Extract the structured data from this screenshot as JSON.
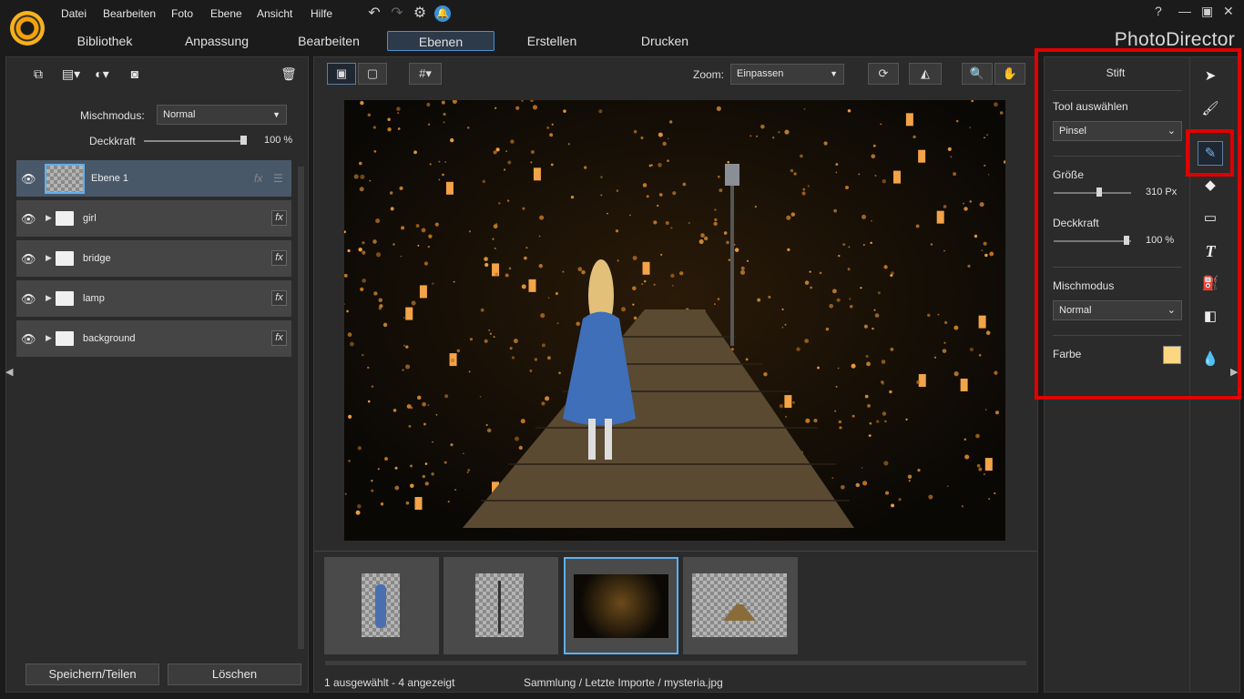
{
  "menu": {
    "file": "Datei",
    "edit": "Bearbeiten",
    "photo": "Foto",
    "layer": "Ebene",
    "view": "Ansicht",
    "help": "Hilfe"
  },
  "tabs": [
    "Bibliothek",
    "Anpassung",
    "Bearbeiten",
    "Ebenen",
    "Erstellen",
    "Drucken"
  ],
  "active_tab": "Ebenen",
  "app_title": "PhotoDirector",
  "window_controls": {
    "help": "?",
    "minimize": "—",
    "restore": "▣",
    "close": "✕"
  },
  "layers_panel": {
    "blend_label": "Mischmodus:",
    "blend_value": "Normal",
    "opacity_label": "Deckkraft",
    "opacity_value": "100 %",
    "layers": [
      {
        "name": "Ebene 1",
        "type": "layer",
        "selected": true
      },
      {
        "name": "girl",
        "type": "group",
        "selected": false
      },
      {
        "name": "bridge",
        "type": "group",
        "selected": false
      },
      {
        "name": "lamp",
        "type": "group",
        "selected": false
      },
      {
        "name": "background",
        "type": "group",
        "selected": false
      }
    ],
    "save_button": "Speichern/Teilen",
    "delete_button": "Löschen"
  },
  "center": {
    "zoom_label": "Zoom:",
    "zoom_value": "Einpassen",
    "status_left": "1 ausgewählt - 4 angezeigt",
    "status_path": "Sammlung / Letzte Importe / mysteria.jpg"
  },
  "tool_panel": {
    "title": "Stift",
    "tool_select_label": "Tool auswählen",
    "tool_select_value": "Pinsel",
    "size_label": "Größe",
    "size_value": "310 Px",
    "opacity_label": "Deckkraft",
    "opacity_value": "100 %",
    "blend_label": "Mischmodus",
    "blend_value": "Normal",
    "color_label": "Farbe",
    "color_value": "#fcd77f"
  },
  "colors": {
    "accent": "#4f8fd0",
    "highlight": "#e00000",
    "thumb_selected": "#5fb0f0"
  }
}
